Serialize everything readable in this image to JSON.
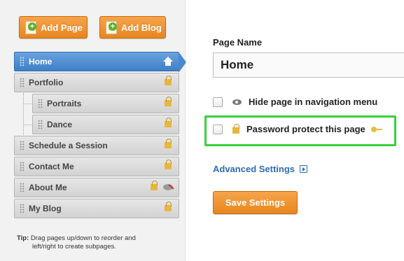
{
  "toolbar": {
    "add_page_label": "Add Page",
    "add_blog_label": "Add Blog"
  },
  "nav": {
    "items": [
      {
        "label": "Home",
        "icon": "home-icon",
        "active": true
      },
      {
        "label": "Portfolio",
        "icon": "lock-icon"
      },
      {
        "label": "Portraits",
        "icon": "lock-icon",
        "subpage": true
      },
      {
        "label": "Dance",
        "icon": "lock-icon",
        "subpage": true
      },
      {
        "label": "Schedule a Session",
        "icon": "lock-icon"
      },
      {
        "label": "Contact Me",
        "icon": "lock-icon"
      },
      {
        "label": "About Me",
        "icon": "lock-icon",
        "extra_icon": "hidden-eye-icon"
      },
      {
        "label": "My Blog",
        "icon": "lock-icon"
      }
    ]
  },
  "tip": {
    "prefix": "Tip:",
    "line1": " Drag pages up/down to reorder and",
    "line2": "left/right to create subpages."
  },
  "settings": {
    "page_name_label": "Page Name",
    "page_name_value": "Home",
    "hide_label": "Hide page in navigation menu",
    "password_label": "Password protect this page",
    "advanced_label": "Advanced Settings",
    "save_label": "Save Settings"
  },
  "colors": {
    "accent_orange": "#e8861f",
    "active_blue": "#3f7fc7",
    "highlight_green": "#38d13a",
    "link_blue": "#2b6db6"
  }
}
